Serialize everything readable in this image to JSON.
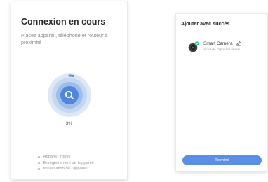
{
  "left_screen": {
    "title": "Connexion en cours",
    "subtitle": "Placez appareil, téléphone et routeur à proximité",
    "progress_percent": 3,
    "progress_label": "3%",
    "steps": [
      "Appareil trouvé",
      "Enregistrement de l'appareil",
      "Initialisation de l'appareil"
    ]
  },
  "right_screen": {
    "title": "Ajouter avec succès",
    "device": {
      "name": "Smart Camera",
      "status": "Ajout de l'appareil réussi"
    },
    "finish_label": "Terminé"
  },
  "colors": {
    "accent_blue": "#5a8fe6",
    "ring_outer": "#dde8f7",
    "ring_mid": "#c3d7f1",
    "ring_inner": "#9dbdea",
    "center": "#4f86df",
    "success_green": "#3ecf8e"
  },
  "icons": {
    "center": "search-icon",
    "device": "camera-icon",
    "edit": "pencil-icon"
  }
}
